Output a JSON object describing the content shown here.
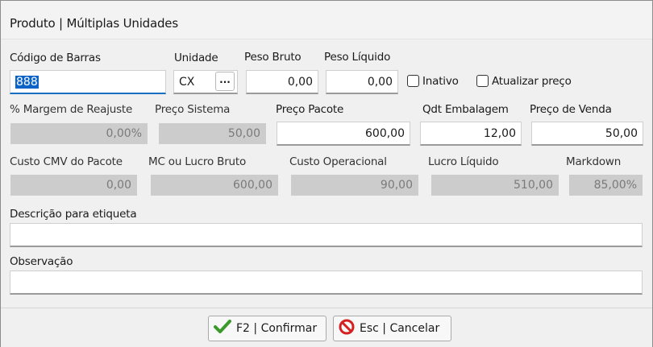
{
  "window": {
    "title": "Produto | Múltiplas Unidades"
  },
  "labels": {
    "codigo_barras": "Código de Barras",
    "unidade": "Unidade",
    "peso_bruto": "Peso Bruto",
    "peso_liquido": "Peso Líquido",
    "inativo": "Inativo",
    "atualizar_preco": "Atualizar preço",
    "margem_reajuste": "% Margem de Reajuste",
    "preco_sistema": "Preço Sistema",
    "preco_pacote": "Preço Pacote",
    "qdt_embalagem": "Qdt Embalagem",
    "preco_venda": "Preço de Venda",
    "custo_cmv": "Custo CMV do Pacote",
    "mc_lucro_bruto": "MC ou Lucro Bruto",
    "custo_operacional": "Custo Operacional",
    "lucro_liquido": "Lucro Líquido",
    "markdown": "Markdown",
    "descricao_etiqueta": "Descrição para etiqueta",
    "observacao": "Observação"
  },
  "values": {
    "codigo_barras": "888",
    "unidade": "CX",
    "unidade_button": "...",
    "peso_bruto": "0,00",
    "peso_liquido": "0,00",
    "margem_reajuste": "0,00%",
    "preco_sistema": "50,00",
    "preco_pacote": "600,00",
    "qdt_embalagem": "12,00",
    "preco_venda": "50,00",
    "custo_cmv": "0,00",
    "mc_lucro_bruto": "600,00",
    "custo_operacional": "90,00",
    "lucro_liquido": "510,00",
    "markdown": "85,00%",
    "descricao_etiqueta": "",
    "observacao": ""
  },
  "checkboxes": {
    "inativo": false,
    "atualizar_preco": false
  },
  "buttons": {
    "confirm": "F2 | Confirmar",
    "cancel": "Esc | Cancelar"
  },
  "icons": {
    "confirm": "check-icon",
    "cancel": "no-entry-icon"
  },
  "colors": {
    "check_green": "#3a9a2a",
    "cancel_red": "#d42020",
    "focus_blue": "#1a6ec0"
  }
}
